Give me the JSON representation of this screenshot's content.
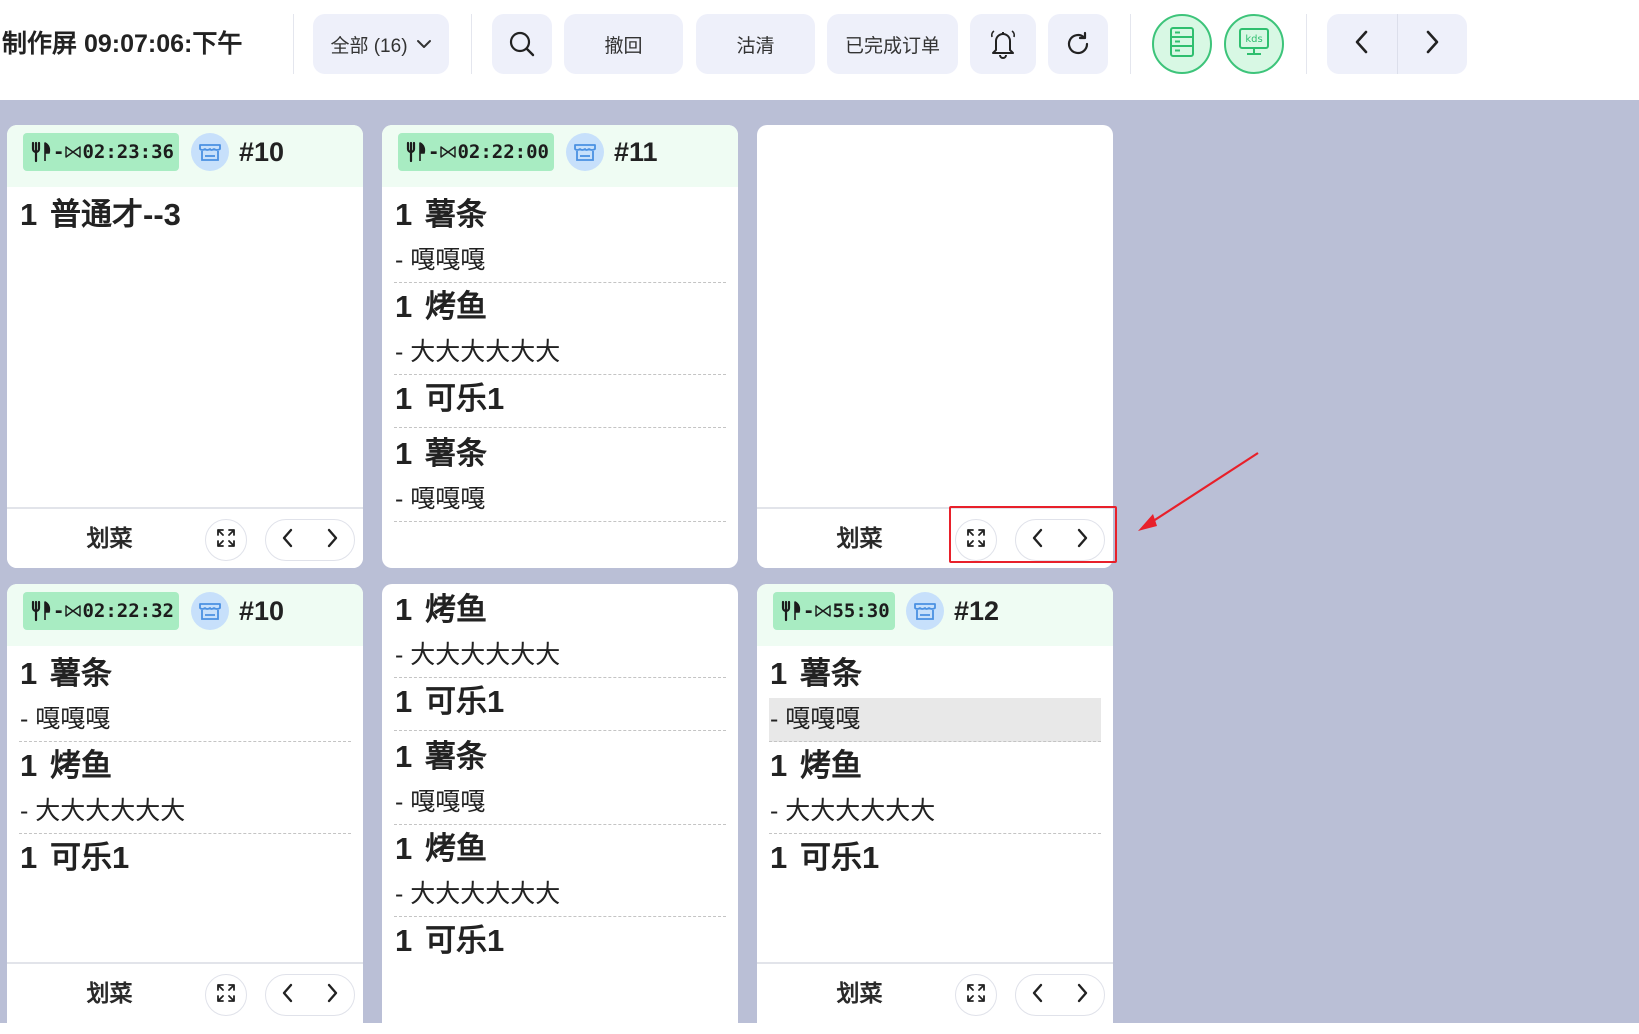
{
  "topbar": {
    "title": "制作屏 09:07:06:下午",
    "filter_label": "全部 (16)",
    "undo_label": "撤回",
    "clear_label": "沽清",
    "completed_label": "已完成订单"
  },
  "cards": [
    {
      "timer": "02:23:36",
      "order_no": "#10",
      "items": [
        {
          "qty": "1",
          "name": "普通才--3",
          "mods": []
        }
      ],
      "footer_label": "划菜"
    },
    {
      "timer": "02:22:00",
      "order_no": "#11",
      "items": [
        {
          "qty": "1",
          "name": "薯条",
          "mods": [
            "- 嘎嘎嘎"
          ]
        },
        {
          "qty": "1",
          "name": "烤鱼",
          "mods": [
            "- 大大大大大大"
          ]
        },
        {
          "qty": "1",
          "name": "可乐1",
          "mods": []
        },
        {
          "qty": "1",
          "name": "薯条",
          "mods": [
            "- 嘎嘎嘎"
          ]
        }
      ]
    },
    {
      "footer_label": "划菜"
    },
    {
      "timer": "02:22:32",
      "order_no": "#10",
      "items": [
        {
          "qty": "1",
          "name": "薯条",
          "mods": [
            "- 嘎嘎嘎"
          ]
        },
        {
          "qty": "1",
          "name": "烤鱼",
          "mods": [
            "- 大大大大大大"
          ]
        },
        {
          "qty": "1",
          "name": "可乐1",
          "mods": []
        }
      ],
      "footer_label": "划菜"
    },
    {
      "items": [
        {
          "qty": "1",
          "name": "烤鱼",
          "mods": [
            "- 大大大大大大"
          ]
        },
        {
          "qty": "1",
          "name": "可乐1",
          "mods": []
        },
        {
          "qty": "1",
          "name": "薯条",
          "mods": [
            "- 嘎嘎嘎"
          ]
        },
        {
          "qty": "1",
          "name": "烤鱼",
          "mods": [
            "- 大大大大大大"
          ]
        },
        {
          "qty": "1",
          "name": "可乐1",
          "mods": []
        }
      ]
    },
    {
      "timer": "55:30",
      "order_no": "#12",
      "items": [
        {
          "qty": "1",
          "name": "薯条",
          "mods": [
            "- 嘎嘎嘎"
          ]
        },
        {
          "qty": "1",
          "name": "烤鱼",
          "mods": [
            "- 大大大大大大"
          ]
        },
        {
          "qty": "1",
          "name": "可乐1",
          "mods": []
        }
      ],
      "footer_label": "划菜"
    }
  ],
  "icons": {
    "filter_chevron": "chevron-down-icon",
    "search": "search-icon",
    "bell": "bell-icon",
    "refresh": "refresh-icon",
    "layout": "server-list-icon",
    "kds": "kds-monitor-icon",
    "prev": "chevron-left-icon",
    "next": "chevron-right-icon",
    "dine_in": "fork-knife-icon",
    "store": "store-icon",
    "expand": "expand-icon"
  },
  "kds_icon_text": "kds",
  "colors": {
    "board_bg": "#babfd6",
    "header_tint": "#effcf3",
    "timer_tag": "#a8ecc2",
    "green_accent": "#3dc47a",
    "store_badge": "#c7e0fb",
    "annotation_red": "#e8202a"
  }
}
